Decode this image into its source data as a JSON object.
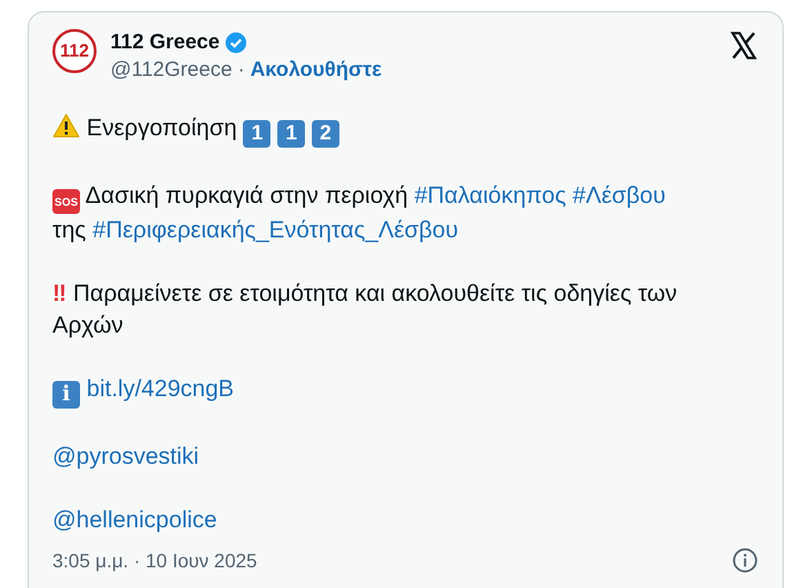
{
  "author": {
    "name": "112 Greece",
    "verified": true,
    "handle": "@112Greece",
    "separator": "·",
    "follow": "Ακολουθήστε",
    "avatar_text": "112"
  },
  "paragraphs": [
    {
      "segments": [
        {
          "kind": "warning"
        },
        {
          "kind": "text",
          "text": "Ενεργοποίηση"
        },
        {
          "kind": "keycap",
          "text": "1"
        },
        {
          "kind": "keycap",
          "text": "1"
        },
        {
          "kind": "keycap",
          "text": "2"
        }
      ]
    },
    {
      "segments": [
        {
          "kind": "sos",
          "text": "SOS"
        },
        {
          "kind": "text",
          "text": "Δασική πυρκαγιά στην περιοχή"
        },
        {
          "kind": "link",
          "text": "#Παλαιόκηπος"
        },
        {
          "kind": "link",
          "text": "#Λέσβου"
        },
        {
          "kind": "text",
          "text": "της"
        },
        {
          "kind": "link",
          "text": "#Περιφερειακής_Ενότητας_Λέσβου"
        }
      ]
    },
    {
      "segments": [
        {
          "kind": "bang",
          "text": "‼"
        },
        {
          "kind": "text",
          "text": "Παραμείνετε σε ετοιμότητα και ακολουθείτε τις οδηγίες των Αρχών"
        }
      ]
    },
    {
      "segments": [
        {
          "kind": "info",
          "text": "i"
        },
        {
          "kind": "link",
          "text": "bit.ly/429cngB"
        }
      ]
    },
    {
      "segments": [
        {
          "kind": "link",
          "text": "@pyrosvestiki"
        }
      ]
    },
    {
      "segments": [
        {
          "kind": "link",
          "text": "@hellenicpolice"
        }
      ]
    }
  ],
  "timestamp": "3:05 μ.μ. · 10 Ιουν 2025"
}
